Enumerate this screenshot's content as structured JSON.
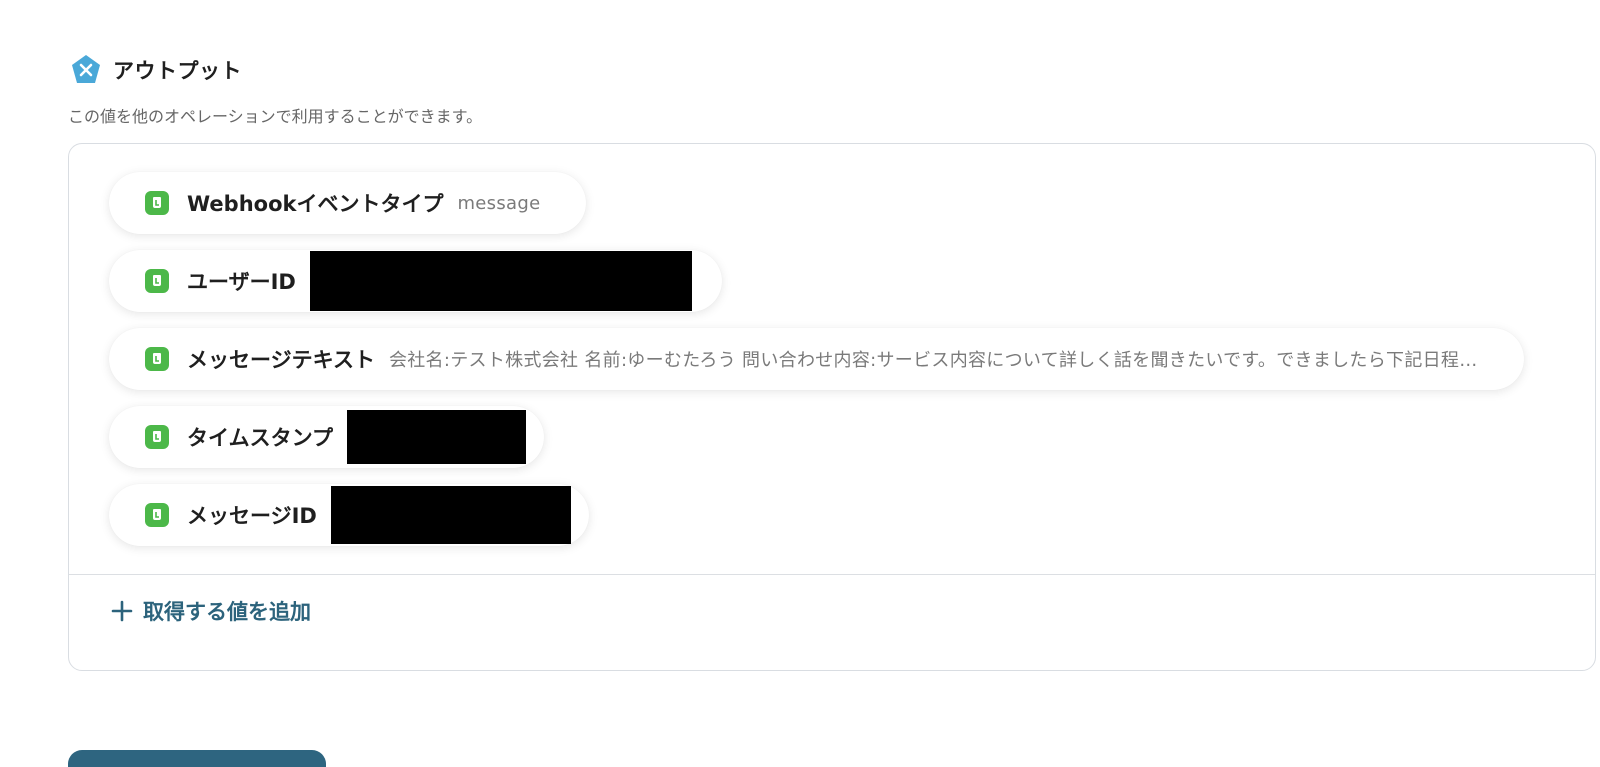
{
  "section": {
    "title": "アウトプット",
    "description": "この値を他のオペレーションで利用することができます。",
    "icon": "variable-x-icon",
    "icon_color": "#4aa8d8"
  },
  "outputs": [
    {
      "label": "Webhookイベントタイプ",
      "value": "message",
      "redacted": false
    },
    {
      "label": "ユーザーID",
      "value": "",
      "redacted": true
    },
    {
      "label": "メッセージテキスト",
      "value": "会社名:テスト株式会社 名前:ゆーむたろう 問い合わせ内容:サービス内容について詳しく話を聞きたいです。できましたら下記日程…",
      "redacted": false
    },
    {
      "label": "タイムスタンプ",
      "value": "",
      "redacted": true
    },
    {
      "label": "メッセージID",
      "value": "",
      "redacted": true
    }
  ],
  "add_value": {
    "label": "取得する値を追加",
    "icon": "plus-icon"
  },
  "colors": {
    "app_icon": "#4cb849",
    "accent": "#2c637c",
    "button": "#2e6580"
  }
}
